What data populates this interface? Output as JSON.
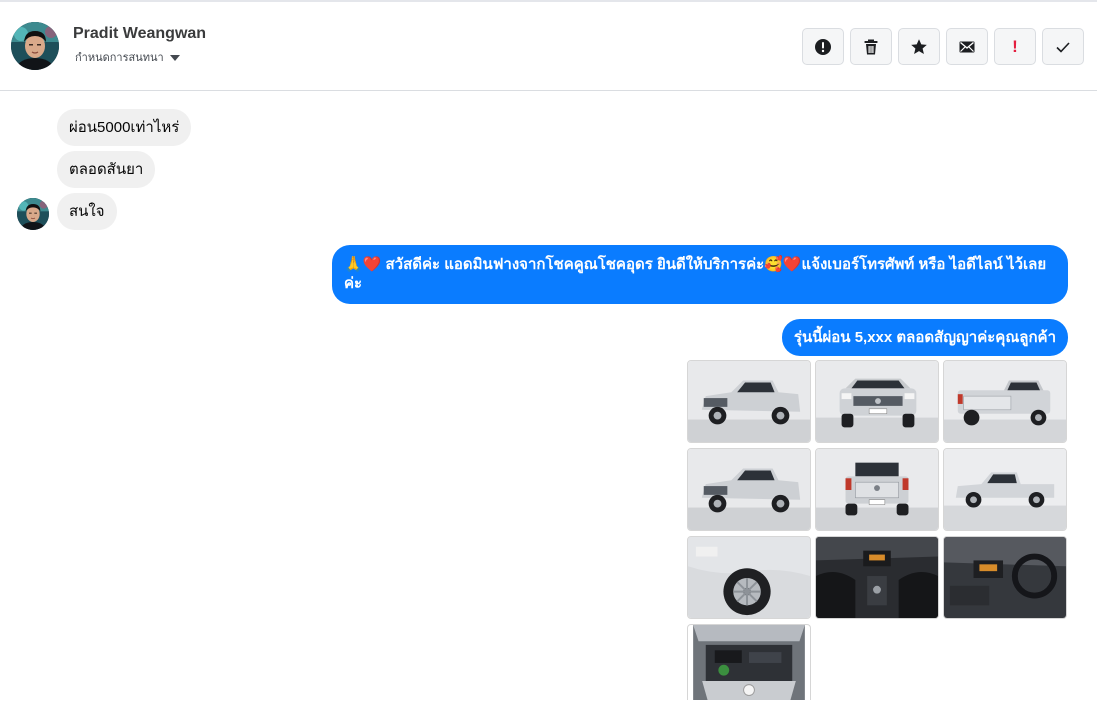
{
  "contact": {
    "name": "Pradit Weangwan",
    "subtitle": "กำหนดการสนทนา"
  },
  "toolbar": {
    "buttons": [
      {
        "icon": "alert-circle-icon",
        "name": "report-button"
      },
      {
        "icon": "trash-icon",
        "name": "delete-button"
      },
      {
        "icon": "star-icon",
        "name": "star-button"
      },
      {
        "icon": "envelope-icon",
        "name": "mark-unread-button"
      },
      {
        "icon": "exclamation-icon",
        "name": "important-button",
        "glyph": "!"
      },
      {
        "icon": "check-icon",
        "name": "done-button"
      }
    ]
  },
  "messages": {
    "incoming": [
      "ผ่อน5000เท่าไหร่",
      "ตลอดสันยา",
      "สนใจ"
    ],
    "outgoing": [
      "🙏❤️ สวัสดีค่ะ แอดมินฟางจากโชคคูณโชคอุดร ยินดีให้บริการค่ะ🥰❤️แจ้งเบอร์โทรศัพท์ หรือ ไอดีไลน์  ไว้เลย",
      "ค่ะ",
      "รุ่นนี้ผ่อน 5,xxx ตลอดสัญญาค่ะคุณลูกค้า"
    ]
  },
  "photos": [
    {
      "view": "front-left"
    },
    {
      "view": "front"
    },
    {
      "view": "rear-right"
    },
    {
      "view": "front-left-high"
    },
    {
      "view": "rear"
    },
    {
      "view": "side"
    },
    {
      "view": "wheel"
    },
    {
      "view": "interior-console"
    },
    {
      "view": "interior-dash"
    },
    {
      "view": "engine"
    }
  ],
  "colors": {
    "outgoing_bubble": "#0a7cff",
    "incoming_bubble": "#f0f0f0",
    "important": "#e41e3f"
  }
}
